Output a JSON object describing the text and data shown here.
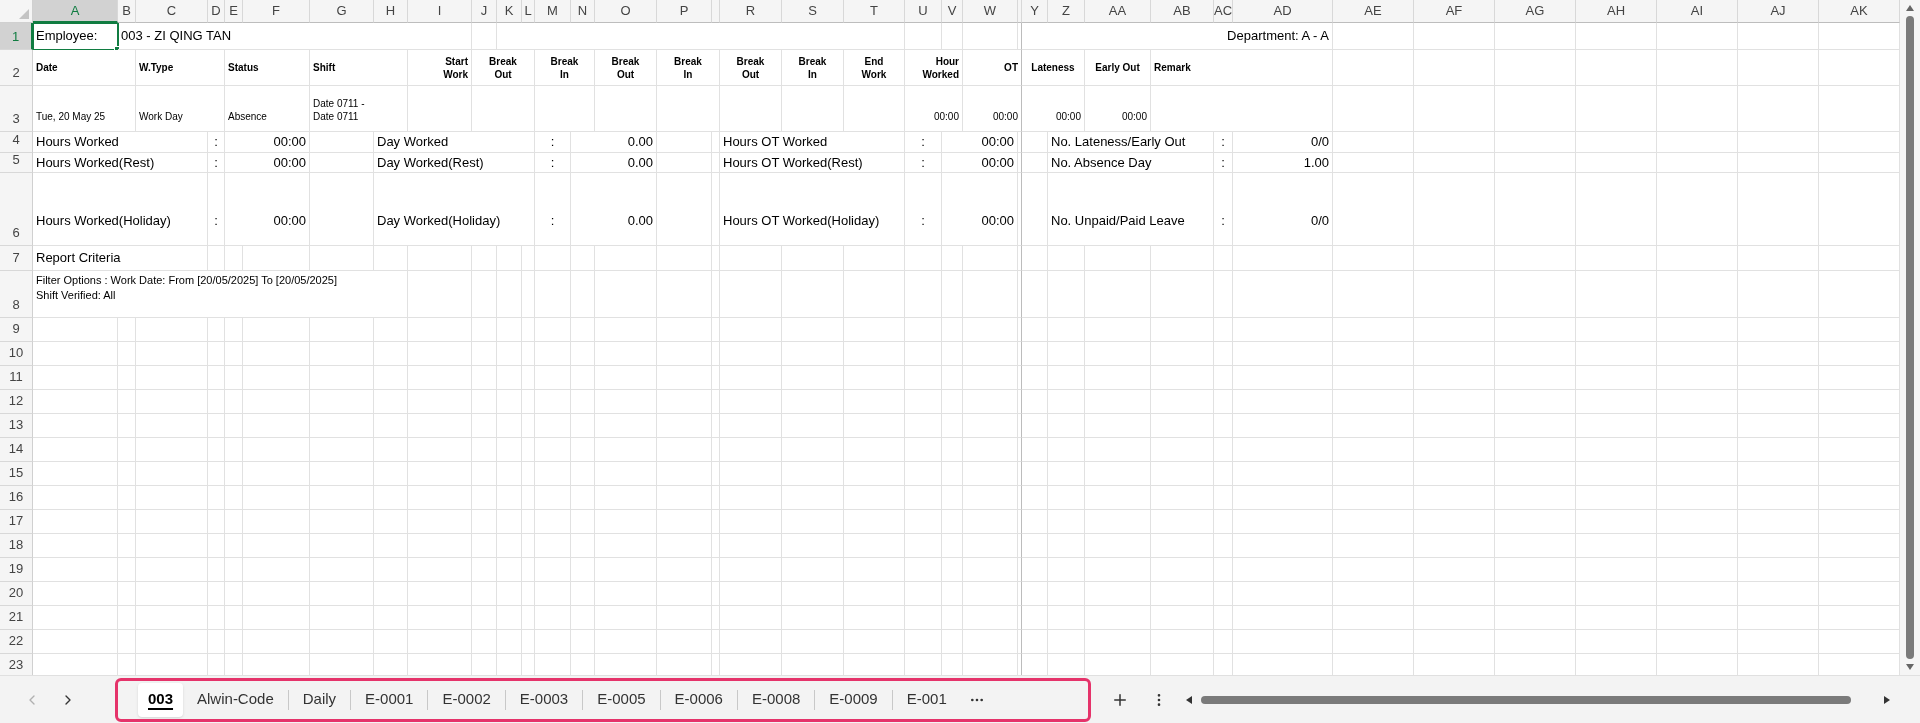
{
  "columns": [
    {
      "label": "A",
      "selected": true
    },
    {
      "label": "B",
      "selected": false
    },
    {
      "label": "C",
      "selected": false
    },
    {
      "label": "D",
      "selected": false
    },
    {
      "label": "E",
      "selected": false
    },
    {
      "label": "F",
      "selected": false
    },
    {
      "label": "G",
      "selected": false
    },
    {
      "label": "H",
      "selected": false
    },
    {
      "label": "I",
      "selected": false
    },
    {
      "label": "J",
      "selected": false
    },
    {
      "label": "K",
      "selected": false
    },
    {
      "label": "L",
      "selected": false
    },
    {
      "label": "M",
      "selected": false
    },
    {
      "label": "N",
      "selected": false
    },
    {
      "label": "O",
      "selected": false
    },
    {
      "label": "P",
      "selected": false
    },
    {
      "selected": false
    },
    {
      "label": "R",
      "selected": false
    },
    {
      "label": "S",
      "selected": false
    },
    {
      "label": "T",
      "selected": false
    },
    {
      "label": "U",
      "selected": false
    },
    {
      "label": "V",
      "selected": false
    },
    {
      "label": "W",
      "selected": false
    },
    {
      "selected": false
    },
    {
      "label": "Y",
      "selected": false
    },
    {
      "label": "Z",
      "selected": false
    },
    {
      "label": "AA",
      "selected": false
    },
    {
      "label": "AB",
      "selected": false
    },
    {
      "label": "AC",
      "selected": false
    },
    {
      "label": "AD",
      "selected": false
    },
    {
      "label": "AE",
      "selected": false
    },
    {
      "label": "AF",
      "selected": false
    },
    {
      "label": "AG",
      "selected": false
    },
    {
      "label": "AH",
      "selected": false
    },
    {
      "label": "AI",
      "selected": false
    },
    {
      "label": "AJ",
      "selected": false
    },
    {
      "label": "AK",
      "selected": false
    }
  ],
  "rows": [
    {
      "number": "1",
      "selected": true,
      "cells": [
        {
          "text": "Employee:",
          "active": true
        },
        {
          "text": "003 - ZI QING TAN",
          "active": false
        },
        {
          "text": "Department: A - A",
          "active": false
        }
      ]
    },
    {
      "number": "2",
      "selected": false,
      "cells": [
        {
          "text": "Date",
          "active": false
        },
        {
          "text": "W.Type",
          "active": false
        },
        {
          "text": "Status",
          "active": false
        },
        {
          "text": "Shift",
          "active": false
        },
        {
          "text": "Start\nWork",
          "active": false
        },
        {
          "text": "Break\nOut",
          "active": false
        },
        {
          "text": "Break\nIn",
          "active": false
        },
        {
          "text": "Break\nOut",
          "active": false
        },
        {
          "text": "Break\nIn",
          "active": false
        },
        {
          "text": "Break\nOut",
          "active": false
        },
        {
          "text": "Break\nIn",
          "active": false
        },
        {
          "text": "End\nWork",
          "active": false
        },
        {
          "text": "Hour\nWorked",
          "active": false
        },
        {
          "text": "OT",
          "active": false
        },
        {
          "text": "Lateness",
          "active": false
        },
        {
          "text": "Early Out",
          "active": false
        },
        {
          "text": "Remark",
          "active": false
        }
      ]
    },
    {
      "number": "3",
      "selected": false,
      "cells": [
        {
          "text": "Tue, 20 May 25",
          "active": false
        },
        {
          "text": "Work Day",
          "active": false
        },
        {
          "text": "Absence",
          "active": false
        },
        {
          "text": "Date 0711 -\nDate 0711",
          "active": false
        },
        {
          "text": "00:00",
          "active": false
        },
        {
          "text": "00:00",
          "active": false
        },
        {
          "text": "00:00",
          "active": false
        },
        {
          "text": "00:00",
          "active": false
        }
      ]
    },
    {
      "number": "4",
      "selected": false,
      "cells": [
        {
          "text": "Hours Worked",
          "active": false
        },
        {
          "text": ":",
          "active": false
        },
        {
          "text": "00:00",
          "active": false
        },
        {
          "text": "Day Worked",
          "active": false
        },
        {
          "text": ":",
          "active": false
        },
        {
          "text": "0.00",
          "active": false
        },
        {
          "text": "Hours OT Worked",
          "active": false
        },
        {
          "text": ":",
          "active": false
        },
        {
          "text": "00:00",
          "active": false
        },
        {
          "text": "No. Lateness/Early Out",
          "active": false
        },
        {
          "text": ":",
          "active": false
        },
        {
          "text": "0/0",
          "active": false
        }
      ]
    },
    {
      "number": "5",
      "selected": false,
      "cells": [
        {
          "text": "Hours Worked(Rest)",
          "active": false
        },
        {
          "text": ":",
          "active": false
        },
        {
          "text": "00:00",
          "active": false
        },
        {
          "text": "Day Worked(Rest)",
          "active": false
        },
        {
          "text": ":",
          "active": false
        },
        {
          "text": "0.00",
          "active": false
        },
        {
          "text": "Hours OT Worked(Rest)",
          "active": false
        },
        {
          "text": ":",
          "active": false
        },
        {
          "text": "00:00",
          "active": false
        },
        {
          "text": "No. Absence Day",
          "active": false
        },
        {
          "text": ":",
          "active": false
        },
        {
          "text": "1.00",
          "active": false
        }
      ]
    },
    {
      "number": "6",
      "selected": false,
      "cells": [
        {
          "text": "Hours Worked(Holiday)",
          "active": false
        },
        {
          "text": ":",
          "active": false
        },
        {
          "text": "00:00",
          "active": false
        },
        {
          "text": "Day Worked(Holiday)",
          "active": false
        },
        {
          "text": ":",
          "active": false
        },
        {
          "text": "0.00",
          "active": false
        },
        {
          "text": "Hours OT Worked(Holiday)",
          "active": false
        },
        {
          "text": ":",
          "active": false
        },
        {
          "text": "00:00",
          "active": false
        },
        {
          "text": "No. Unpaid/Paid Leave",
          "active": false
        },
        {
          "text": ":",
          "active": false
        },
        {
          "text": "0/0",
          "active": false
        }
      ]
    },
    {
      "number": "7",
      "selected": false,
      "cells": [
        {
          "text": "Report Criteria",
          "active": false
        }
      ]
    },
    {
      "number": "8",
      "selected": false,
      "cells": [
        {
          "text": "Filter Options : Work Date: From [20/05/2025] To [20/05/2025]\nShift Verified: All",
          "active": false
        }
      ]
    },
    {
      "number": "9",
      "selected": false
    },
    {
      "number": "10",
      "selected": false
    },
    {
      "number": "11",
      "selected": false
    },
    {
      "number": "12",
      "selected": false
    },
    {
      "number": "13",
      "selected": false
    },
    {
      "number": "14",
      "selected": false
    },
    {
      "number": "15",
      "selected": false
    },
    {
      "number": "16",
      "selected": false
    },
    {
      "number": "17",
      "selected": false
    },
    {
      "number": "18",
      "selected": false
    },
    {
      "number": "19",
      "selected": false
    },
    {
      "number": "20",
      "selected": false
    },
    {
      "number": "21",
      "selected": false
    },
    {
      "number": "22",
      "selected": false
    },
    {
      "number": "23",
      "selected": false
    }
  ],
  "sheet_nav": [
    {
      "kind": "previous",
      "disabled": true
    },
    {
      "kind": "next",
      "disabled": false
    }
  ],
  "sheet_tabs": [
    {
      "label": "003",
      "selected": true
    },
    {
      "label": "Alwin-Code",
      "selected": false
    },
    {
      "label": "Daily",
      "selected": false
    },
    {
      "label": "E-0001",
      "selected": false
    },
    {
      "label": "E-0002",
      "selected": false
    },
    {
      "label": "E-0003",
      "selected": false
    },
    {
      "label": "E-0005",
      "selected": false
    },
    {
      "label": "E-0006",
      "selected": false
    },
    {
      "label": "E-0008",
      "selected": false
    },
    {
      "label": "E-0009",
      "selected": false
    },
    {
      "label": "E-001",
      "selected": false
    }
  ]
}
